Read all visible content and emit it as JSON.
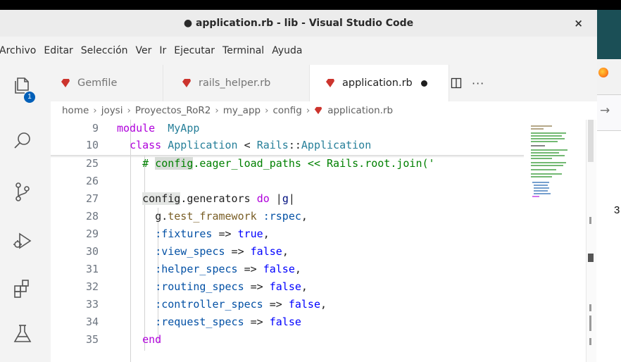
{
  "window": {
    "title": "● application.rb - lib - Visual Studio Code",
    "close_icon": "×"
  },
  "menu": [
    "Archivo",
    "Editar",
    "Selección",
    "Ver",
    "Ir",
    "Ejecutar",
    "Terminal",
    "Ayuda"
  ],
  "activity_bar": {
    "items": [
      "explorer-icon",
      "search-icon",
      "source-control-icon",
      "run-debug-icon",
      "extensions-icon",
      "testing-icon"
    ],
    "explorer_badge": "1"
  },
  "tabs": [
    {
      "label": "Gemfile",
      "active": false
    },
    {
      "label": "rails_helper.rb",
      "active": false
    },
    {
      "label": "application.rb",
      "active": true,
      "dirty": true
    }
  ],
  "editor_actions": {
    "split_icon": "split-editor-icon",
    "more": "···"
  },
  "breadcrumb": [
    "home",
    "joysi",
    "Proyectos_RoR2",
    "my_app",
    "config",
    "application.rb"
  ],
  "code_lines": [
    {
      "n": "9",
      "tokens": [
        [
          "kw",
          "module"
        ],
        [
          "",
          "  "
        ],
        [
          "cls",
          "MyApp"
        ]
      ]
    },
    {
      "n": "10",
      "tokens": [
        [
          "",
          "  "
        ],
        [
          "kw",
          "class"
        ],
        [
          "",
          " "
        ],
        [
          "cls",
          "Application"
        ],
        [
          "",
          " < "
        ],
        [
          "cls",
          "Rails"
        ],
        [
          "",
          "::"
        ],
        [
          "cls",
          "Application"
        ]
      ]
    },
    {
      "n": "25",
      "tokens": [
        [
          "",
          "    "
        ],
        [
          "cm",
          "# "
        ],
        [
          "cm-hl",
          "config"
        ],
        [
          "cm",
          ".eager_load_paths << Rails.root.join('"
        ]
      ]
    },
    {
      "n": "26",
      "tokens": []
    },
    {
      "n": "27",
      "tokens": [
        [
          "",
          "    "
        ],
        [
          "hl",
          "config"
        ],
        [
          "",
          ".generators "
        ],
        [
          "kw",
          "do"
        ],
        [
          "",
          " |"
        ],
        [
          "var",
          "g"
        ],
        [
          "",
          "|"
        ]
      ]
    },
    {
      "n": "28",
      "tokens": [
        [
          "",
          "      "
        ],
        [
          "",
          "g."
        ],
        [
          "meth",
          "test_framework"
        ],
        [
          "",
          " "
        ],
        [
          "sym",
          ":rspec"
        ],
        [
          "",
          ","
        ]
      ]
    },
    {
      "n": "29",
      "tokens": [
        [
          "",
          "      "
        ],
        [
          "sym",
          ":fixtures"
        ],
        [
          "",
          " => "
        ],
        [
          "bool",
          "true"
        ],
        [
          "",
          ","
        ]
      ]
    },
    {
      "n": "30",
      "tokens": [
        [
          "",
          "      "
        ],
        [
          "sym",
          ":view_specs"
        ],
        [
          "",
          " => "
        ],
        [
          "bool",
          "false"
        ],
        [
          "",
          ","
        ]
      ]
    },
    {
      "n": "31",
      "tokens": [
        [
          "",
          "      "
        ],
        [
          "sym",
          ":helper_specs"
        ],
        [
          "",
          " => "
        ],
        [
          "bool",
          "false"
        ],
        [
          "",
          ","
        ]
      ]
    },
    {
      "n": "32",
      "tokens": [
        [
          "",
          "      "
        ],
        [
          "sym",
          ":routing_specs"
        ],
        [
          "",
          " => "
        ],
        [
          "bool",
          "false"
        ],
        [
          "",
          ","
        ]
      ]
    },
    {
      "n": "33",
      "tokens": [
        [
          "",
          "      "
        ],
        [
          "sym",
          ":controller_specs"
        ],
        [
          "",
          " => "
        ],
        [
          "bool",
          "false"
        ],
        [
          "",
          ","
        ]
      ]
    },
    {
      "n": "34",
      "tokens": [
        [
          "",
          "      "
        ],
        [
          "sym",
          ":request_specs"
        ],
        [
          "",
          " => "
        ],
        [
          "bool",
          "false"
        ]
      ]
    },
    {
      "n": "35",
      "tokens": [
        [
          "",
          "    "
        ],
        [
          "kw",
          "end"
        ]
      ]
    }
  ],
  "background_text": "3"
}
